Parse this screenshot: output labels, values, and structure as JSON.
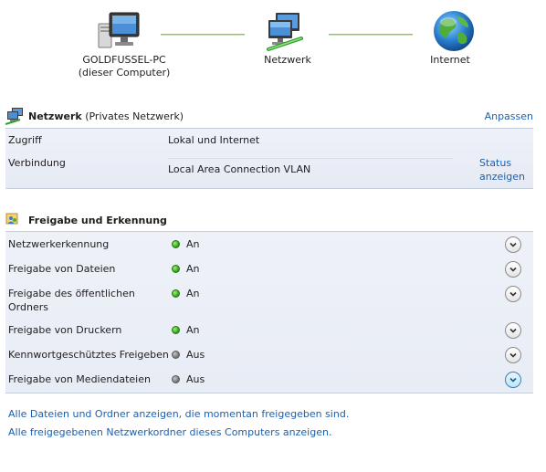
{
  "network_map": {
    "computer": {
      "name": "GOLDFUSSEL-PC",
      "subtitle": "(dieser Computer)"
    },
    "network": {
      "name": "Netzwerk"
    },
    "internet": {
      "name": "Internet"
    }
  },
  "network_section": {
    "title_bold": "Netzwerk",
    "title_rest": " (Privates Netzwerk)",
    "customize_link": "Anpassen",
    "rows": [
      {
        "label": "Zugriff",
        "value": "Lokal und Internet"
      },
      {
        "label": "Verbindung",
        "value": "Local Area Connection VLAN",
        "link_line1": "Status",
        "link_line2": "anzeigen"
      }
    ]
  },
  "sharing_section": {
    "title": "Freigabe und Erkennung",
    "items": [
      {
        "label": "Netzwerkerkennung",
        "status": "An"
      },
      {
        "label": "Freigabe von Dateien",
        "status": "An"
      },
      {
        "label_line1": "Freigabe des öffentlichen",
        "label_line2": "Ordners",
        "status": "An"
      },
      {
        "label": "Freigabe von Druckern",
        "status": "An"
      },
      {
        "label": "Kennwortgeschütztes Freigeben",
        "status": "Aus"
      },
      {
        "label": "Freigabe von Mediendateien",
        "status": "Aus"
      }
    ]
  },
  "links": {
    "show_files": "Alle Dateien und Ordner anzeigen, die momentan freigegeben sind.",
    "show_folders": "Alle freigegebenen Netzwerkordner dieses Computers anzeigen."
  },
  "colors": {
    "link": "#1c5fb1",
    "status_on": "#2e9a14",
    "status_off": "#6f6f6f",
    "panel": "#eef1f8"
  },
  "icons": [
    "computer-icon",
    "network-icon",
    "globe-icon",
    "network-small-icon",
    "sharing-icon",
    "chevron-down-icon"
  ]
}
